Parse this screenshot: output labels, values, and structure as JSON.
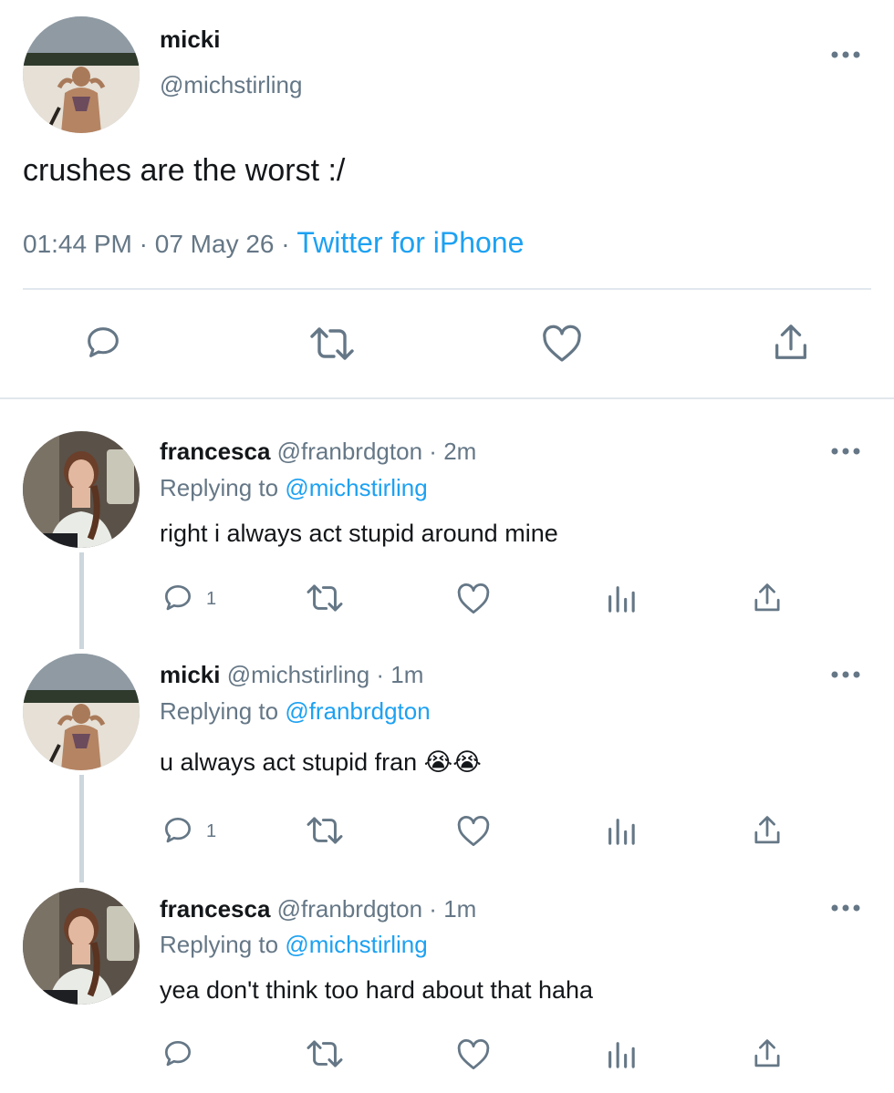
{
  "main_tweet": {
    "display_name": "micki",
    "handle": "@michstirling",
    "text": "crushes are the worst :/",
    "time": "01:44 PM",
    "sep1": "·",
    "date": "07 May 26",
    "sep2": "·",
    "source": "Twitter for iPhone",
    "actions": [
      "reply-icon",
      "retweet-icon",
      "like-icon",
      "share-icon"
    ]
  },
  "replies": [
    {
      "display_name": "francesca",
      "handle": "@franbrdgton",
      "sep": "·",
      "age": "2m",
      "replying_prefix": "Replying to",
      "replying_to": "@michstirling",
      "text": "right i always act stupid around mine",
      "reply_count": "1"
    },
    {
      "display_name": "micki",
      "handle": "@michstirling",
      "sep": "·",
      "age": "1m",
      "replying_prefix": "Replying to",
      "replying_to": "@franbrdgton",
      "text": "u always act stupid fran 😭😭",
      "reply_count": "1"
    },
    {
      "display_name": "francesca",
      "handle": "@franbrdgton",
      "sep": "·",
      "age": "1m",
      "replying_prefix": "Replying to",
      "replying_to": "@michstirling",
      "text": "yea don't think too hard about that haha",
      "reply_count": ""
    }
  ],
  "colors": {
    "link": "#1da1f2",
    "muted": "#657786",
    "text": "#14171a",
    "divider": "#e1e8ed"
  }
}
